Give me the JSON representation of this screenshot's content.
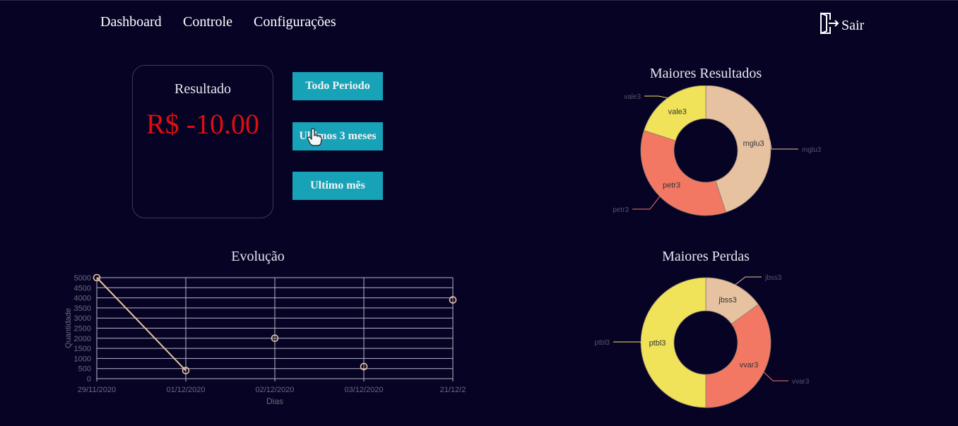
{
  "nav": {
    "items": [
      "Dashboard",
      "Controle",
      "Configurações"
    ],
    "logout_label": "Sair"
  },
  "result": {
    "title": "Resultado",
    "value": "R$ -10.00",
    "value_color": "#e00f0f"
  },
  "period_buttons": [
    "Todo Periodo",
    "Ultimos 3 meses",
    "Ultimo mês"
  ],
  "evolution": {
    "title": "Evolução"
  },
  "top_results": {
    "title": "Maiores Resultados"
  },
  "top_losses": {
    "title": "Maiores Perdas"
  },
  "colors": {
    "background": "#070325",
    "button": "#17a2b8",
    "yellow": "#f0e35a",
    "peach": "#e7c2a1",
    "salmon": "#f37863",
    "line": "#e7c2a1"
  },
  "chart_data": [
    {
      "type": "line",
      "title": "Evolução",
      "xlabel": "Dias",
      "ylabel": "Quantidade",
      "x": [
        "29/11/2020",
        "01/12/2020",
        "02/12/2020",
        "03/12/2020",
        "21/12/2"
      ],
      "series": [
        {
          "values": [
            5000,
            400,
            2000,
            600,
            3900
          ]
        }
      ],
      "line_segments": [
        [
          0,
          1
        ]
      ],
      "yticks": [
        0,
        500,
        1000,
        1500,
        2000,
        2500,
        3000,
        3500,
        4000,
        4500,
        5000
      ],
      "ylim": [
        0,
        5000
      ],
      "grid": true
    },
    {
      "type": "pie",
      "title": "Maiores Resultados",
      "donut": true,
      "labels": [
        "mglu3",
        "petr3",
        "vale3"
      ],
      "values": [
        45,
        35,
        20
      ],
      "colors": [
        "#e7c2a1",
        "#f37863",
        "#f0e35a"
      ]
    },
    {
      "type": "pie",
      "title": "Maiores Perdas",
      "donut": true,
      "labels": [
        "jbss3",
        "vvar3",
        "ptbl3"
      ],
      "values": [
        15,
        35,
        50
      ],
      "colors": [
        "#e7c2a1",
        "#f37863",
        "#f0e35a"
      ]
    }
  ]
}
